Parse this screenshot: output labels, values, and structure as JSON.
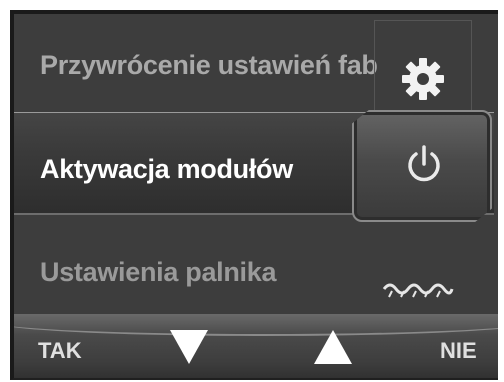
{
  "menu": {
    "items": [
      {
        "label": "Przywrócenie ustawień fab",
        "icon": "gear-icon",
        "selected": false
      },
      {
        "label": "Aktywacja modułów",
        "icon": "power-icon",
        "selected": true
      },
      {
        "label": "Ustawienia palnika",
        "icon": "burner-wave-icon",
        "selected": false
      }
    ]
  },
  "footer": {
    "yes_label": "TAK",
    "no_label": "NIE",
    "down_icon": "arrow-down-icon",
    "up_icon": "arrow-up-icon"
  },
  "colors": {
    "background": "#3d3d3d",
    "selected_text": "#ffffff",
    "inactive_text": "#a9a9a9"
  }
}
